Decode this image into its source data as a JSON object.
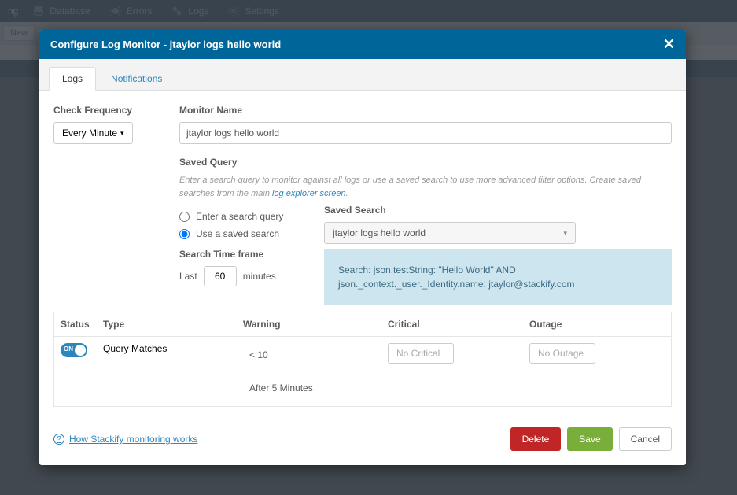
{
  "topnav": {
    "items": [
      {
        "label": "Database"
      },
      {
        "label": "Errors"
      },
      {
        "label": "Logs"
      },
      {
        "label": "Settings"
      }
    ],
    "left_cut": "ng"
  },
  "subbar": {
    "new_label": "New"
  },
  "modal": {
    "title": "Configure Log Monitor - jtaylor logs hello world",
    "tabs": {
      "logs": "Logs",
      "notifications": "Notifications"
    },
    "check_frequency": {
      "label": "Check Frequency",
      "value": "Every Minute"
    },
    "monitor_name": {
      "label": "Monitor Name",
      "value": "jtaylor logs hello world"
    },
    "saved_query": {
      "label": "Saved Query",
      "hint_prefix": "Enter a search query to monitor against all logs or use a saved search to use more advanced filter options. Create saved searches from the main ",
      "hint_link": "log explorer screen",
      "hint_suffix": ".",
      "radio_enter": "Enter a search query",
      "radio_saved": "Use a saved search"
    },
    "saved_search": {
      "label": "Saved Search",
      "value": "jtaylor logs hello world"
    },
    "timeframe": {
      "label": "Search Time frame",
      "prefix": "Last",
      "value": "60",
      "suffix": "minutes"
    },
    "query_preview": "Search: json.testString: \"Hello World\" AND json._context._user._Identity.name: jtaylor@stackify.com",
    "table": {
      "headers": {
        "status": "Status",
        "type": "Type",
        "warning": "Warning",
        "critical": "Critical",
        "outage": "Outage"
      },
      "row": {
        "toggle": "ON",
        "type": "Query Matches",
        "warning_val": "< 10",
        "warning_after": "After 5 Minutes",
        "critical_placeholder": "No Critical",
        "outage_placeholder": "No Outage"
      }
    },
    "footer": {
      "help": "How Stackify monitoring works",
      "delete": "Delete",
      "save": "Save",
      "cancel": "Cancel"
    }
  }
}
